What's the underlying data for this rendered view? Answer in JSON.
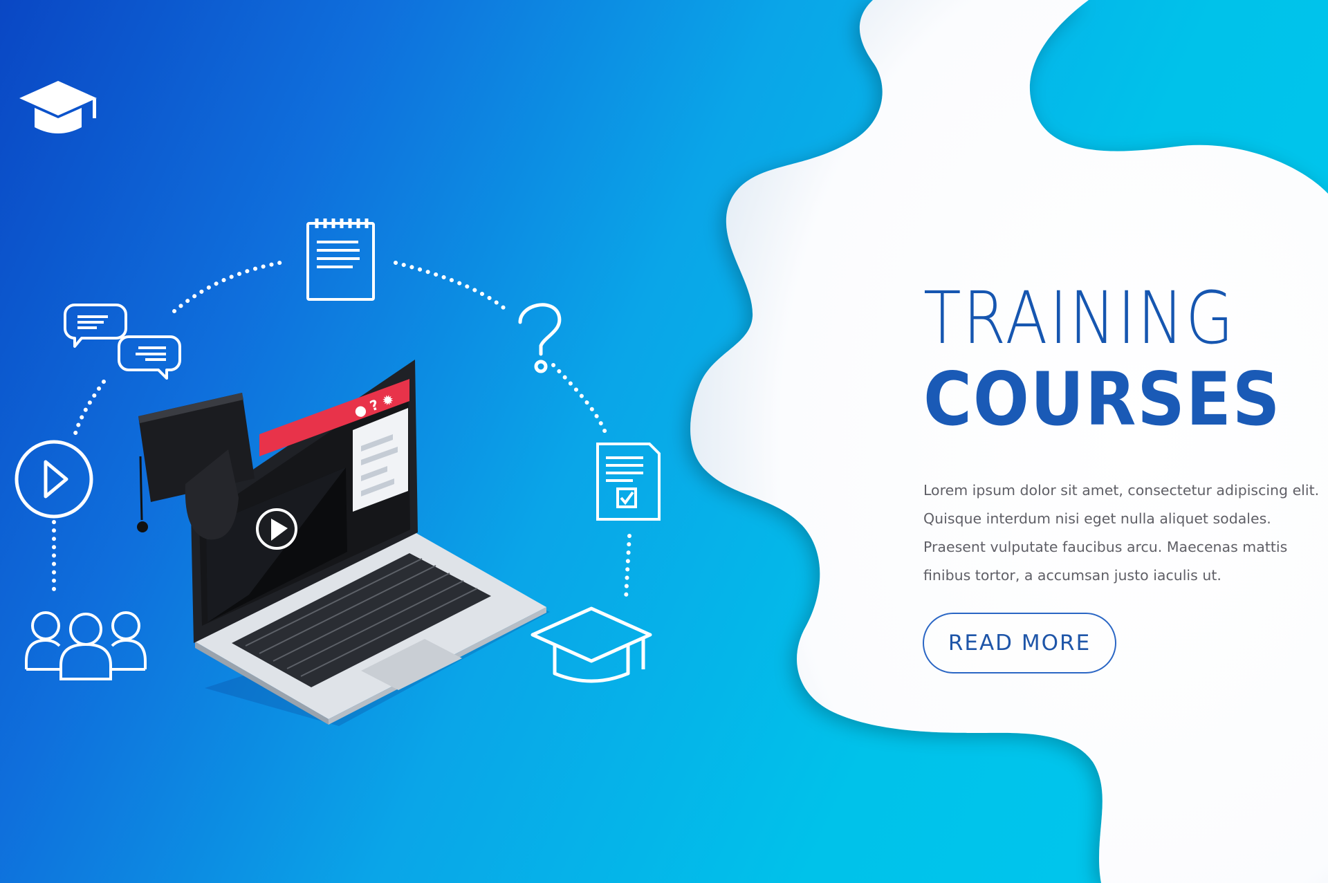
{
  "hero": {
    "title_line1": "TRAINING",
    "title_line2": "COURSES",
    "description_lines": [
      "Lorem ipsum dolor sit amet, consectetur adipiscing elit.",
      "Quisque interdum nisi eget nulla aliquet sodales.",
      "Praesent vulputate faucibus arcu. Maecenas mattis",
      "finibus tortor, a accumsan justo iaculis ut."
    ],
    "button_label": "READ MORE"
  },
  "laptop_toolbar": {
    "icons": "● ? ✹"
  },
  "icons": [
    "graduation-cap-icon",
    "notepad-icon",
    "chat-bubbles-icon",
    "question-mark-icon",
    "play-circle-icon",
    "certificate-icon",
    "users-group-icon",
    "mortarboard-icon"
  ],
  "colors": {
    "gradient_dark": "#0a47c4",
    "gradient_light": "#00c8ee",
    "title": "#1656b0",
    "body_text": "#5f5f66",
    "button_border": "#2a66c4",
    "laptop_accent": "#e8334a"
  }
}
